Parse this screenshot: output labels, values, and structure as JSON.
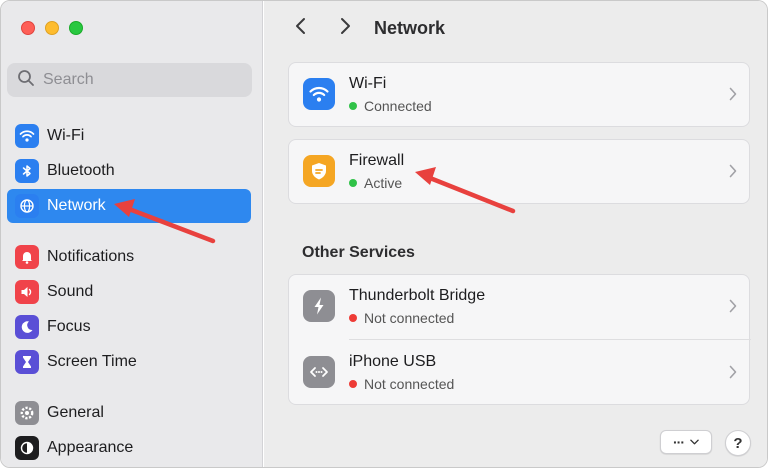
{
  "colors": {
    "accent": "#2e88ef",
    "annotation_arrow": "#e8413e",
    "status_active": "#30c248",
    "status_inactive": "#ee3b36"
  },
  "search": {
    "placeholder": "Search"
  },
  "sidebar": {
    "items": [
      {
        "label": "Wi-Fi",
        "icon": "wifi-icon",
        "color": "#2b7ff0",
        "active": false
      },
      {
        "label": "Bluetooth",
        "icon": "bluetooth-icon",
        "color": "#2b7ff0",
        "active": false
      },
      {
        "label": "Network",
        "icon": "globe-icon",
        "color": "#2b7ff0",
        "active": true
      },
      {
        "label": "Notifications",
        "icon": "bell-icon",
        "color": "#f0434a",
        "active": false
      },
      {
        "label": "Sound",
        "icon": "speaker-icon",
        "color": "#f0434a",
        "active": false
      },
      {
        "label": "Focus",
        "icon": "moon-icon",
        "color": "#5a4fd6",
        "active": false
      },
      {
        "label": "Screen Time",
        "icon": "hourglass-icon",
        "color": "#5a4fd6",
        "active": false
      },
      {
        "label": "General",
        "icon": "gear-icon",
        "color": "#8e8e93",
        "active": false
      },
      {
        "label": "Appearance",
        "icon": "appearance-icon",
        "color": "#1d1d1f",
        "active": false
      }
    ]
  },
  "header": {
    "title": "Network"
  },
  "services": [
    {
      "title": "Wi-Fi",
      "status": "Connected",
      "status_color": "#30c248",
      "icon": "wifi-icon",
      "icon_color": "#2b7ff0"
    },
    {
      "title": "Firewall",
      "status": "Active",
      "status_color": "#30c248",
      "icon": "shield-icon",
      "icon_color": "#f5a623"
    }
  ],
  "other_services": {
    "heading": "Other Services",
    "items": [
      {
        "title": "Thunderbolt Bridge",
        "status": "Not connected",
        "status_color": "#ee3b36",
        "icon": "thunderbolt-icon",
        "icon_color": "#8e8e93"
      },
      {
        "title": "iPhone USB",
        "status": "Not connected",
        "status_color": "#ee3b36",
        "icon": "usb-icon",
        "icon_color": "#8e8e93"
      }
    ]
  },
  "footer": {
    "more_label": "···",
    "help_label": "?"
  }
}
